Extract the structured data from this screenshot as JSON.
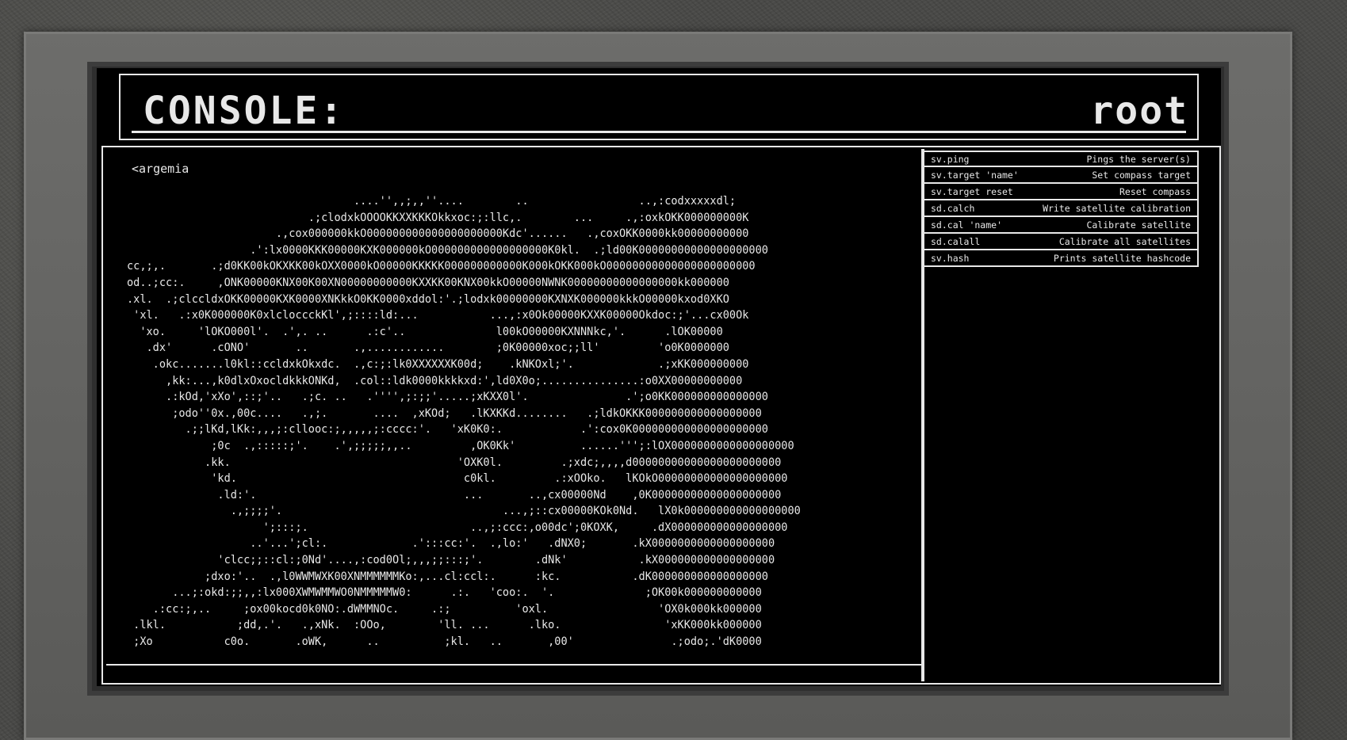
{
  "console": {
    "title": "CONSOLE:",
    "user": "root"
  },
  "output": {
    "prompt": "<argemia",
    "ascii_lines": [
      "                                   ....'',,;,,''....        ..                 ..,:codxxxxxdl;",
      "                            .;clodxkOOOOKKXXKKKOkkxoc:;:llc,.        ...     .,:oxkOKK000000000K",
      "                       .,cox000000kkO000000000000000000000Kdc'......   .,coxOKK0000kk00000000000",
      "                   .':lx0000KKK00000KXK000000kO000000000000000000K0kl.  .;ld00K00000000000000000000",
      "cc,;,.       .;d0KK00kOKXKK00kOXX0000kO00000KKKKK000000000000K000kOKK000kO00000000000000000000000",
      "od..;cc:.     ,ONK00000KNX00K00XN00000000000KXXKK00KNX00kkO00000NWNK00000000000000000kk000000",
      ".xl.  .;clccldxOKK00000KXK0000XNKkkO0KK0000xddol:'.;lodxk00000000KXNXK000000kkkO00000kxod0XKO",
      " 'xl.   .:x0K000000K0xlcloccckKl',;::::ld:...           ...,:x0Ok00000KXXK00000Okdoc:;'...cx00Ok",
      "  'xo.     'lOKO000l'.  .',. ..      .:c'..              l00kO00000KXNNNkc,'.      .lOK00000",
      "   .dx'      .cONO'       ..       .,............        ;0K00000xoc;;ll'         'o0K0000000",
      "    .okc.......l0kl::ccldxkOkxdc.  .,c:;:lk0XXXXXXK00d;    .kNKOxl;'.             .;xKK000000000",
      "      ,kk:...,k0dlxOxocldkkkONKd,  .col::ldk0000kkkkxd:',ld0X0o;...............:o0XX00000000000",
      "      .:kOd,'xXo',::;'..   .;c. ..   .'''',;:;;'.....;xKXX0l'.               .';o0KK000000000000000",
      "       ;odo''0x.,00c....   .,;.       ....  ,xKOd;   .lKXKKd........   .;ldkOKKK000000000000000000",
      "         .;;lKd,lKk:,,,;:cllooc:;,,,,,;:cccc:'.   'xK0K0:.            .':cox0K000000000000000000000",
      "             ;0c  .,:::::;'.    .',;;;;;,,..         ,OK0Kk'          ......''';:lOX0000000000000000000",
      "            .kk.                                   'OXK0l.         .;xdc;,,,,d00000000000000000000000",
      "             'kd.                                   c0kl.         .:xOOko.   lKOkO00000000000000000000",
      "              .ld:'.                                ...       ..,cx00000Nd    ,0K00000000000000000000",
      "                .,;;;;'.                                  ...,;::cx00000KOk0Nd.   lX0k000000000000000000",
      "                     ';:::;.                         ..,;:ccc:,o00dc';0KOXK,     .dX000000000000000000",
      "                   ..'...';cl:.             .':::cc:'.  .,lo:'   .dNX0;       .kX0000000000000000000",
      "              'clcc;;::cl:;0Nd'....,:cod0Ol;,,,;;:::;'.        .dNk'           .kX000000000000000000",
      "            ;dxo:'..  .,l0WWMWXK00XNMMMMMMKo:,...cl:ccl:.      :kc.           .dK000000000000000000",
      "       ...;:okd:;;,,:lx000XWMWMMWO0NMMMMMW0:      .:.   'coo:.  '.              ;OK00k000000000000",
      "    .:cc:;,..     ;ox00kocd0k0NO:.dWMMNOc.     .:;          'oxl.                 'OX0k000kk000000",
      " .lkl.           ;dd,.'.   .,xNk.  :OOo,        'll. ...      .lko.                'xKK000kk000000",
      " ;Xo           c0o.       .oWK,      ..          ;kl.   ..       ,00'               .;odo;.'dK0000"
    ]
  },
  "commands": [
    {
      "cmd": "sv.ping",
      "desc": "Pings the server(s)"
    },
    {
      "cmd": "sv.target 'name'",
      "desc": "Set compass target"
    },
    {
      "cmd": "sv.target reset",
      "desc": "Reset compass"
    },
    {
      "cmd": "sd.calch",
      "desc": "Write satellite calibration"
    },
    {
      "cmd": "sd.cal 'name'",
      "desc": "Calibrate satellite"
    },
    {
      "cmd": "sd.calall",
      "desc": "Calibrate all satellites"
    },
    {
      "cmd": "sv.hash",
      "desc": "Prints satellite hashcode"
    }
  ],
  "input": {
    "value": ""
  }
}
